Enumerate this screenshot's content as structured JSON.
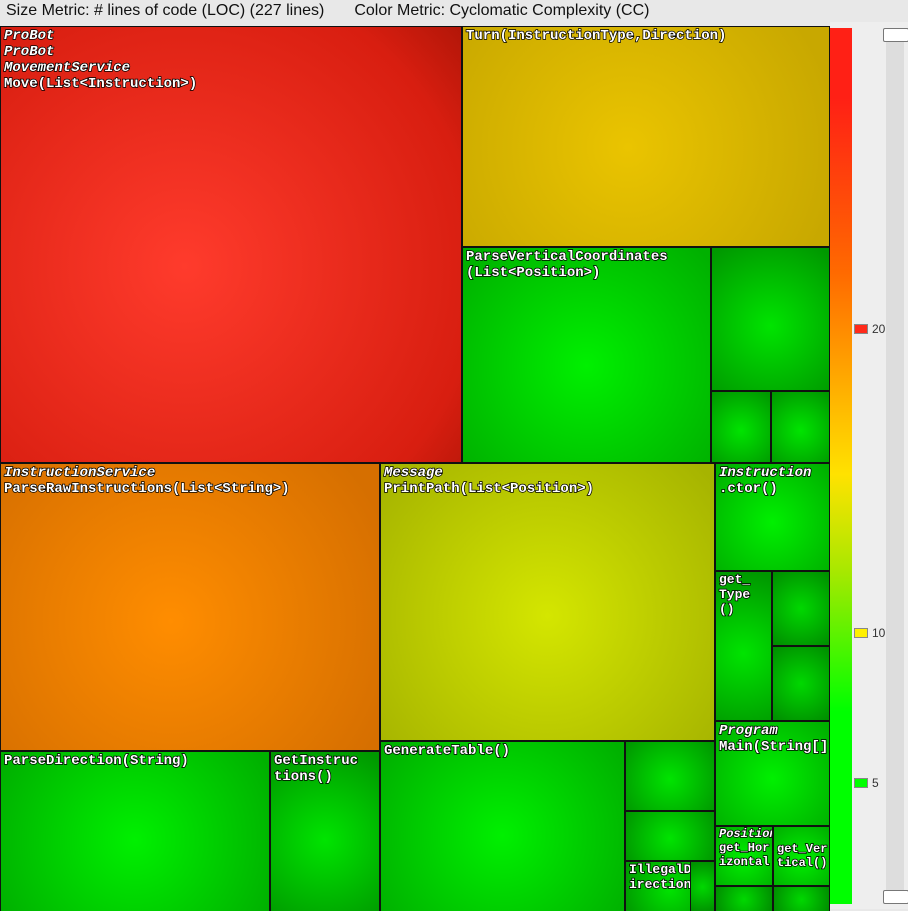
{
  "header": {
    "size_metric": "Size Metric: # lines of code (LOC) (227 lines)",
    "color_metric": "Color Metric: Cyclomatic Complexity (CC)"
  },
  "legend": {
    "ticks": [
      {
        "value": "20",
        "color": "#ff2a1a",
        "pos": 306
      },
      {
        "value": "10",
        "color": "#fff000",
        "pos": 610
      },
      {
        "value": "5",
        "color": "#00ff00",
        "pos": 760
      }
    ]
  },
  "chart_data": {
    "type": "treemap",
    "size_metric": "LOC",
    "color_metric": "Cyclomatic Complexity",
    "total_loc": 227,
    "color_scale": {
      "min": 1,
      "mid": 10,
      "max": 25
    },
    "nodes": [
      {
        "id": "move",
        "cc": 24,
        "loc": 55,
        "breadcrumb": [
          "ProBot",
          "ProBot",
          "MovementService",
          "Move(List<Instruction>)"
        ]
      },
      {
        "id": "turn",
        "cc": 17,
        "loc": 28,
        "breadcrumb": [
          "Turn(InstructionType,Direction)"
        ]
      },
      {
        "id": "pvc",
        "cc": 5,
        "loc": 18,
        "breadcrumb": [
          "ParseVerticalCoordinates(List<Position>)"
        ]
      },
      {
        "id": "pvc2",
        "cc": 4,
        "loc": 7,
        "breadcrumb": []
      },
      {
        "id": "pvc3",
        "cc": 3,
        "loc": 3,
        "breadcrumb": []
      },
      {
        "id": "pvc4",
        "cc": 3,
        "loc": 3,
        "breadcrumb": []
      },
      {
        "id": "pri",
        "cc": 14,
        "loc": 24,
        "breadcrumb": [
          "InstructionService",
          "ParseRawInstructions(List<String>)"
        ]
      },
      {
        "id": "pdir",
        "cc": 5,
        "loc": 12,
        "breadcrumb": [
          "ParseDirection(String)"
        ]
      },
      {
        "id": "gins",
        "cc": 4,
        "loc": 5,
        "breadcrumb": [
          "GetInstructions()"
        ]
      },
      {
        "id": "pp",
        "cc": 11,
        "loc": 24,
        "breadcrumb": [
          "Message",
          "PrintPath(List<Position>)"
        ]
      },
      {
        "id": "gt",
        "cc": 4,
        "loc": 12,
        "breadcrumb": [
          "GenerateTable()"
        ]
      },
      {
        "id": "m1",
        "cc": 2,
        "loc": 2,
        "breadcrumb": []
      },
      {
        "id": "m2",
        "cc": 2,
        "loc": 2,
        "breadcrumb": []
      },
      {
        "id": "illd",
        "cc": 2,
        "loc": 2,
        "breadcrumb": [
          "IllegalDirection()"
        ]
      },
      {
        "id": "m4",
        "cc": 2,
        "loc": 1,
        "breadcrumb": []
      },
      {
        "id": "ictor",
        "cc": 2,
        "loc": 4,
        "breadcrumb": [
          "Instruction",
          ".ctor()"
        ]
      },
      {
        "id": "gtype",
        "cc": 1,
        "loc": 3,
        "breadcrumb": [
          "get_Type()"
        ]
      },
      {
        "id": "ix1",
        "cc": 1,
        "loc": 2,
        "breadcrumb": []
      },
      {
        "id": "ix2",
        "cc": 1,
        "loc": 2,
        "breadcrumb": []
      },
      {
        "id": "main",
        "cc": 2,
        "loc": 5,
        "breadcrumb": [
          "Program",
          "Main(String[])"
        ]
      },
      {
        "id": "ghor",
        "cc": 1,
        "loc": 2,
        "breadcrumb": [
          "Position",
          "get_Horizontal()"
        ]
      },
      {
        "id": "gver",
        "cc": 1,
        "loc": 2,
        "breadcrumb": [
          "get_Vertical()"
        ]
      },
      {
        "id": "p1",
        "cc": 1,
        "loc": 1,
        "breadcrumb": []
      },
      {
        "id": "p2",
        "cc": 1,
        "loc": 1,
        "breadcrumb": []
      }
    ]
  },
  "cells": {
    "move_l1": "ProBot",
    "move_l2": "ProBot",
    "move_l3": "MovementService",
    "move_l4": "Move(List<Instruction>)",
    "turn": "Turn(InstructionType,Direction)",
    "pvc_l1": "ParseVerticalCoordinates",
    "pvc_l2": "(List<Position>)",
    "is_l1": "InstructionService",
    "is_l2": "ParseRawInstructions(List<String>)",
    "msg_l1": "Message",
    "msg_l2": "PrintPath(List<Position>)",
    "ins_l1": "Instruction",
    "ins_l2": ".ctor()",
    "gtype": "get_\nType\n()",
    "prog_l1": "Program",
    "prog_l2": "Main(String[])",
    "pos_l1": "Position",
    "pos_l2": "get_Hor\nizontal",
    "pos_l3": "get_Ver\ntical()",
    "pdir": "ParseDirection(String)",
    "gins": "GetInstruc\ntions()",
    "gt": "GenerateTable()",
    "illd": "IllegalD\nirection"
  }
}
